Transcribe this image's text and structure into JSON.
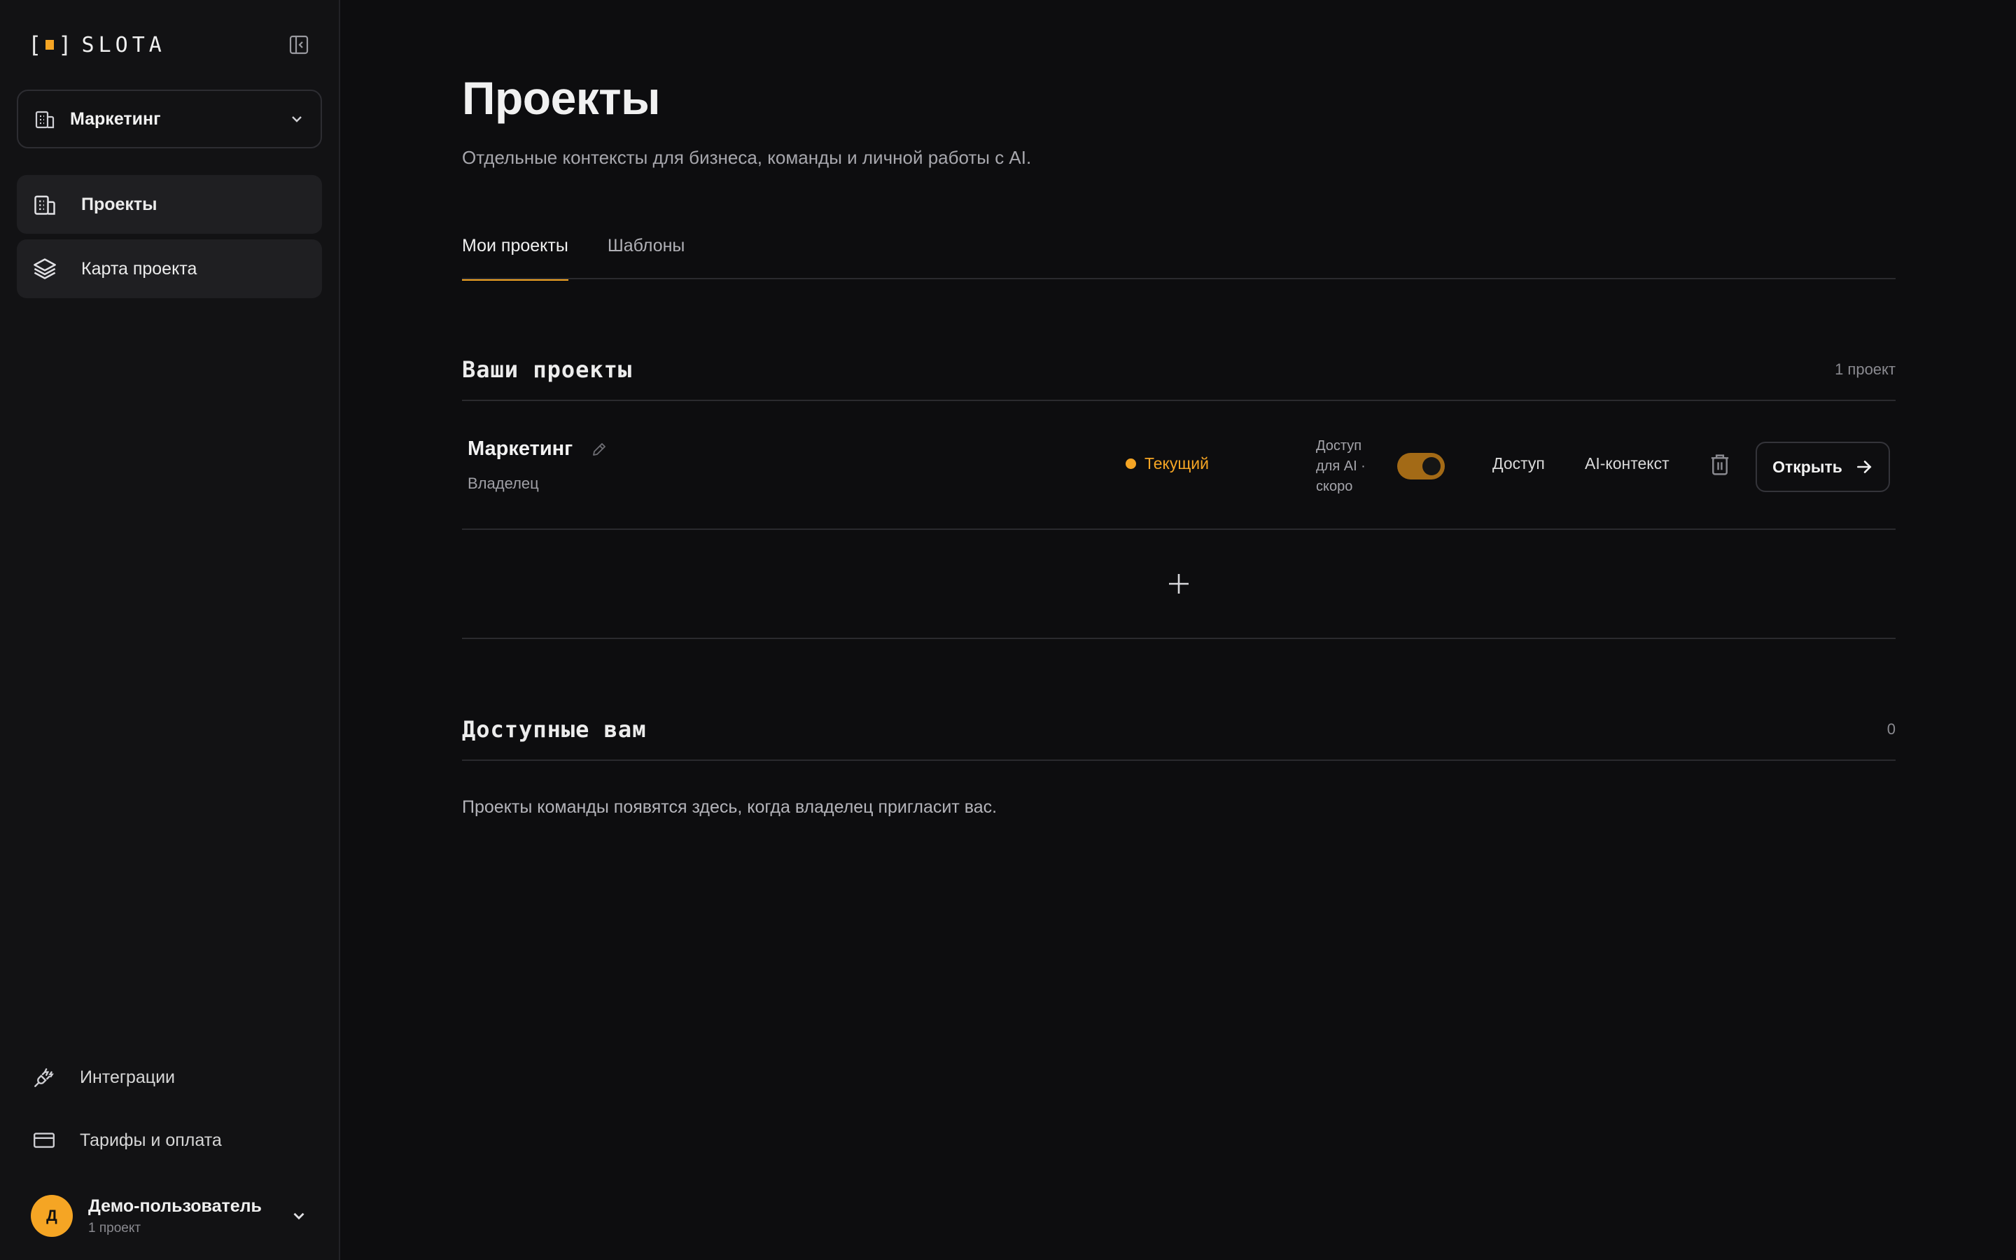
{
  "brand": {
    "name": "SLOTA",
    "accent": "#f5a524"
  },
  "workspace": {
    "name": "Маркетинг"
  },
  "nav": {
    "items": [
      {
        "label": "Проекты"
      },
      {
        "label": "Карта проекта"
      }
    ]
  },
  "sidebar_bottom": {
    "integrations": "Интеграции",
    "billing": "Тарифы и оплата"
  },
  "user": {
    "initial": "Д",
    "name": "Демо-пользователь",
    "sub": "1 проект"
  },
  "page": {
    "title": "Проекты",
    "subtitle": "Отдельные контексты для бизнеса, команды и личной работы с AI."
  },
  "tabs": [
    {
      "label": "Мои проекты",
      "active": true
    },
    {
      "label": "Шаблоны",
      "active": false
    }
  ],
  "my_projects": {
    "title": "Ваши проекты",
    "count": "1 проект",
    "rows": [
      {
        "name": "Маркетинг",
        "role": "Владелец",
        "status": "Текущий",
        "ai_access_label": "Доступ для AI · скоро",
        "ai_access_on": true,
        "access_label": "Доступ",
        "ai_context_label": "AI-контекст",
        "open_label": "Открыть"
      }
    ]
  },
  "shared": {
    "title": "Доступные вам",
    "count": "0",
    "empty": "Проекты команды появятся здесь, когда владелец пригласит вас."
  }
}
